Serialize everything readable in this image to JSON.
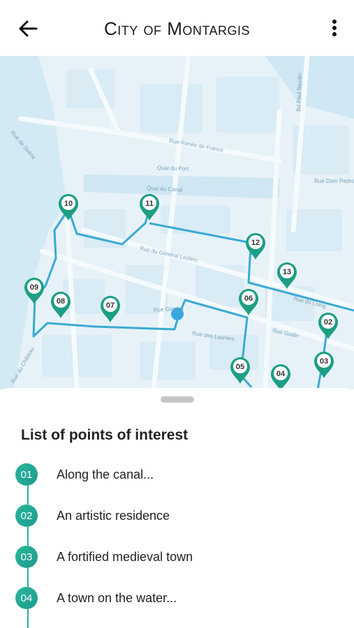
{
  "header": {
    "title": "City of Montargis",
    "back_icon": "arrow-left-icon",
    "menu_icon": "more-vertical-icon"
  },
  "map": {
    "route_color": "#3aaad2",
    "marker_color": "#1e9e84",
    "water_color": "#c9e6f2",
    "street_labels": [
      "Rue de Sirène",
      "Rue Renée de France",
      "Quai du Port",
      "Quai du Canal",
      "Rue Dom Pedro",
      "Rue du Général Leclerc",
      "Rue du Loing",
      "Rue Girodet",
      "Rue des Lauriers",
      "Rue Gudin",
      "Rue du Château",
      "Bd Paul Baudin"
    ],
    "markers": [
      "10",
      "11",
      "12",
      "13",
      "09",
      "08",
      "07",
      "06",
      "02",
      "05",
      "04",
      "03"
    ]
  },
  "list": {
    "title": "List of points of interest",
    "items": [
      {
        "num": "01",
        "label": "Along the canal..."
      },
      {
        "num": "02",
        "label": "An artistic residence"
      },
      {
        "num": "03",
        "label": "A fortified medieval town"
      },
      {
        "num": "04",
        "label": "A town on the water..."
      }
    ]
  }
}
